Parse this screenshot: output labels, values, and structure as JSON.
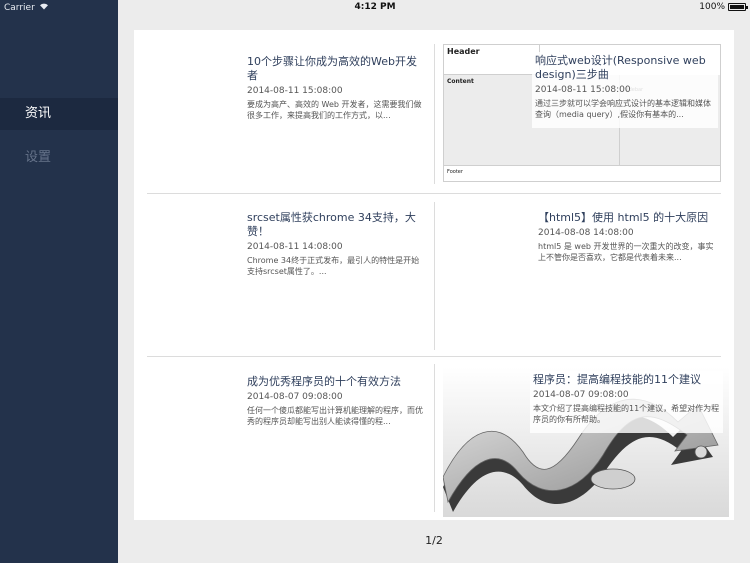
{
  "status": {
    "carrier": "Carrier",
    "time": "4:12 PM",
    "battery": "100%",
    "battery_level": 1.0
  },
  "sidebar": {
    "items": [
      {
        "label": "资讯"
      },
      {
        "label": "设置"
      }
    ]
  },
  "articles": [
    {
      "title": "10个步骤让你成为高效的Web开发者",
      "date": "2014-08-11 15:08:00",
      "summary": "要成为高产、高效的 Web 开发者，这需要我们做很多工作，来提高我们的工作方式，以..."
    },
    {
      "title": "响应式web设计(Responsive web design)三步曲",
      "date": "2014-08-11 15:08:00",
      "summary": "通过三步就可以学会响应式设计的基本逻辑和媒体查询（media query）,假设你有基本的...",
      "thumb": {
        "header": "Header",
        "content": "Content",
        "sidebar": "Sidebar",
        "footer": "Footer"
      }
    },
    {
      "title": "srcset属性获chrome 34支持，大赞！",
      "date": "2014-08-11 14:08:00",
      "summary": "Chrome 34终于正式发布，最引人的特性是开始支持srcset属性了。..."
    },
    {
      "title": "【html5】使用 html5 的十大原因",
      "date": "2014-08-08 14:08:00",
      "summary": "html5 是 web 开发世界的一次重大的改变，事实上不管你是否喜欢，它都是代表着未来..."
    },
    {
      "title": "成为优秀程序员的十个有效方法",
      "date": "2014-08-07 09:08:00",
      "summary": "任何一个傻瓜都能写出计算机能理解的程序，而优秀的程序员却能写出别人能读得懂的程..."
    },
    {
      "title": "程序员：提高编程技能的11个建议",
      "date": "2014-08-07 09:08:00",
      "summary": "本文介绍了提高编程技能的11个建议，希望对作为程序员的你有所帮助。"
    }
  ],
  "pager": {
    "text": "1/2"
  }
}
